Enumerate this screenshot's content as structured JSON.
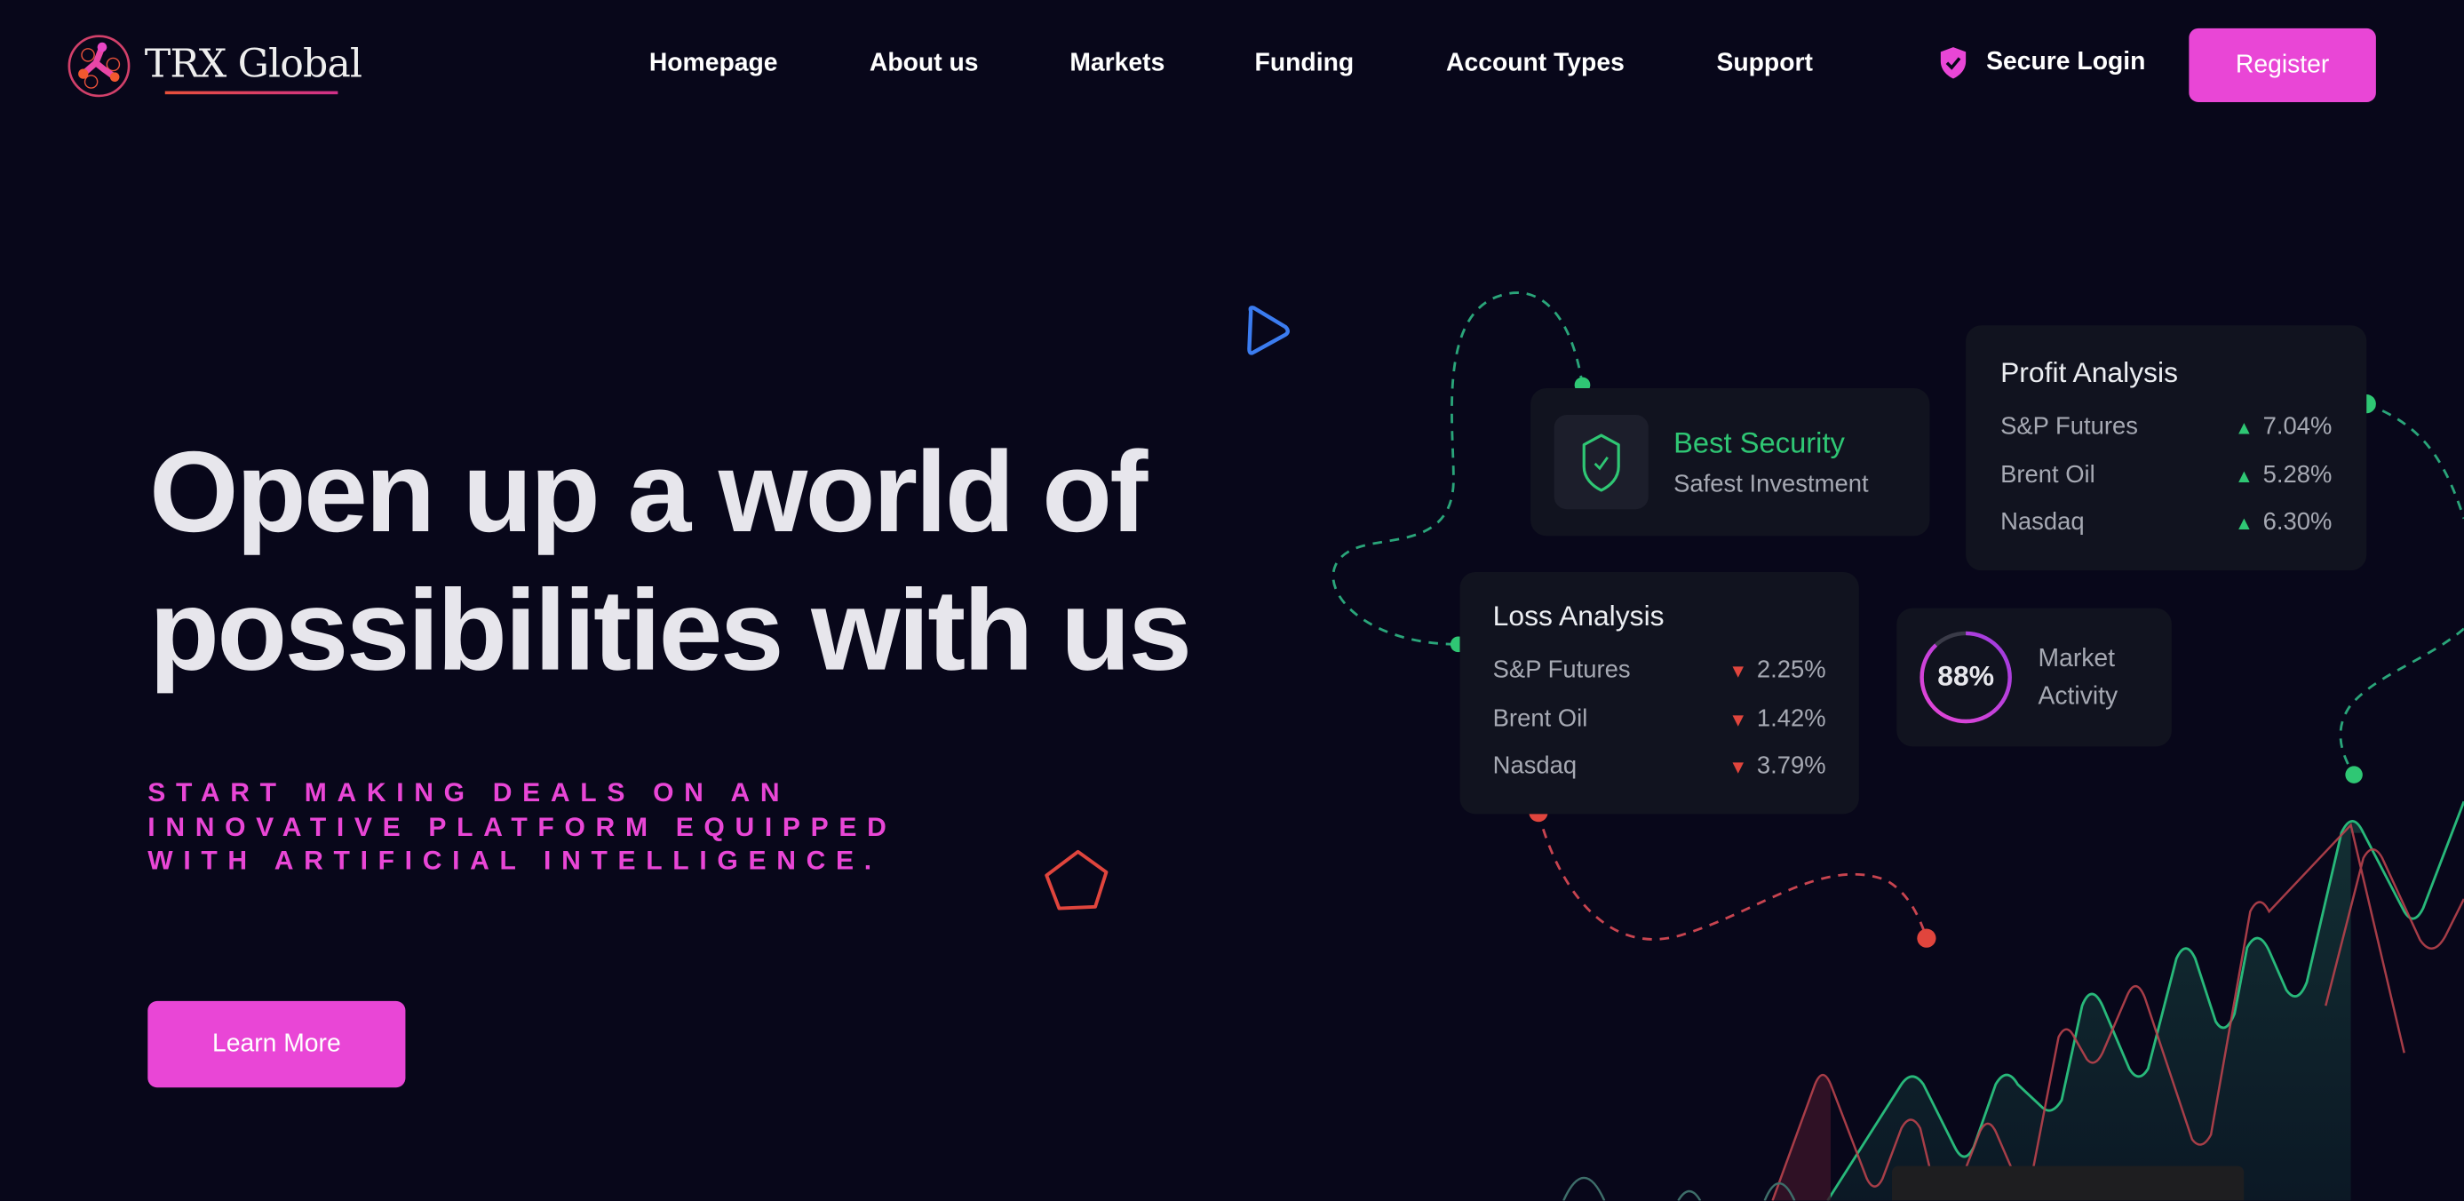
{
  "brand": {
    "name": "TRX Global"
  },
  "nav": {
    "items": [
      "Homepage",
      "About us",
      "Markets",
      "Funding",
      "Account Types",
      "Support"
    ]
  },
  "header": {
    "secure_login": "Secure Login",
    "register": "Register"
  },
  "hero": {
    "title_line1": "Open up a world of",
    "title_line2": "possibilities with us",
    "subtitle_lines": [
      "START MAKING DEALS ON AN",
      "INNOVATIVE PLATFORM EQUIPPED",
      "WITH ARTIFICIAL INTELLIGENCE."
    ],
    "cta": "Learn More"
  },
  "security_card": {
    "title": "Best Security",
    "subtitle": "Safest Investment"
  },
  "profit_card": {
    "title": "Profit Analysis",
    "rows": [
      {
        "label": "S&P Futures",
        "value": "7.04%"
      },
      {
        "label": "Brent Oil",
        "value": "5.28%"
      },
      {
        "label": "Nasdaq",
        "value": "6.30%"
      }
    ]
  },
  "loss_card": {
    "title": "Loss Analysis",
    "rows": [
      {
        "label": "S&P Futures",
        "value": "2.25%"
      },
      {
        "label": "Brent Oil",
        "value": "1.42%"
      },
      {
        "label": "Nasdaq",
        "value": "3.79%"
      }
    ]
  },
  "market_card": {
    "percent": "88%",
    "progress": 0.88,
    "label_line1": "Market",
    "label_line2": "Activity"
  },
  "colors": {
    "accent": "#e946d6",
    "profit": "#2fc774",
    "loss": "#e0453d",
    "background": "#08071a",
    "card": "#11131f"
  },
  "icons": {
    "shield": "shield-check-icon",
    "up": "triangle-up-icon",
    "down": "triangle-down-icon",
    "play": "play-icon",
    "pentagon": "pentagon-icon"
  }
}
